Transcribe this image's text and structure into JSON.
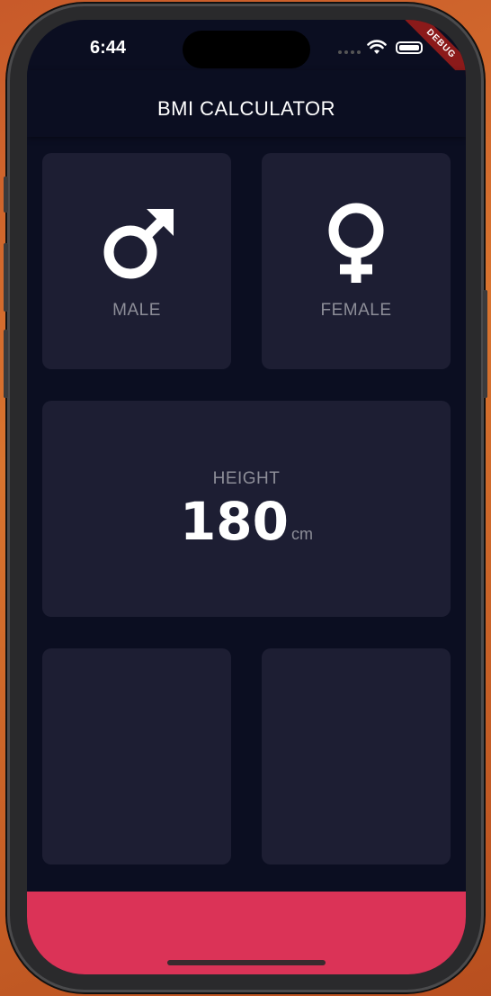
{
  "status_bar": {
    "time": "6:44"
  },
  "debug_banner": {
    "label": "DEBUG"
  },
  "app_bar": {
    "title": "BMI CALCULATOR"
  },
  "gender_cards": {
    "male": {
      "label": "MALE",
      "icon": "male-symbol-icon"
    },
    "female": {
      "label": "FEMALE",
      "icon": "female-symbol-icon"
    }
  },
  "height_card": {
    "label": "HEIGHT",
    "value": "180",
    "unit": "cm"
  },
  "colors": {
    "background": "#0b0e21",
    "card": "#1d1e33",
    "label": "#8d8e98",
    "accent": "#db3357"
  }
}
